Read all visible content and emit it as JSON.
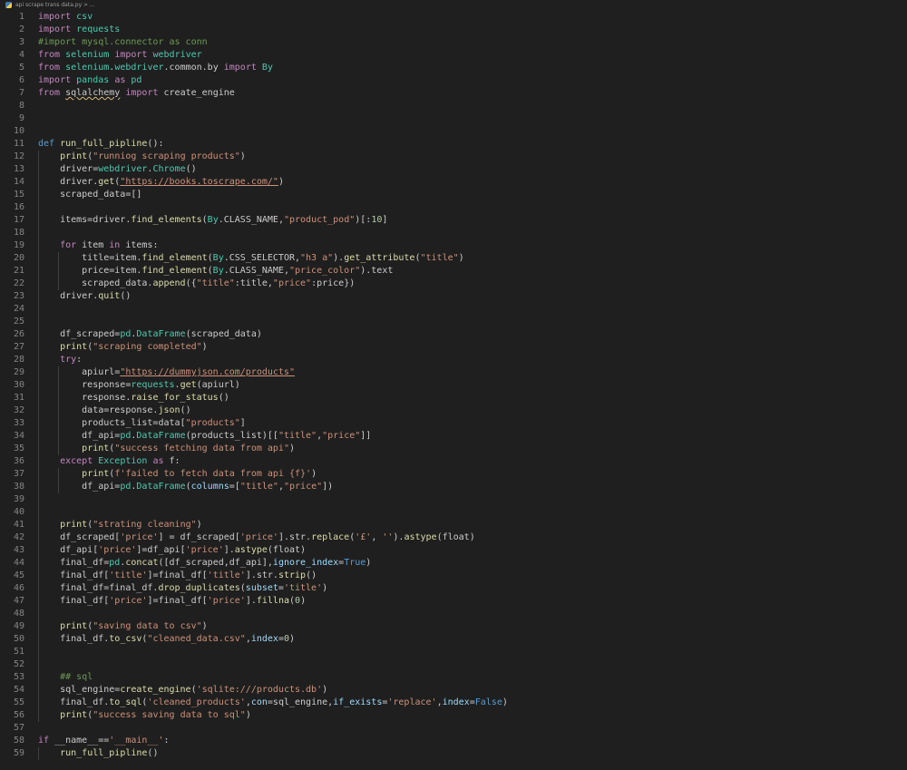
{
  "tab": {
    "breadcrumb": "api scrape trans data.py > ..."
  },
  "lines": [
    {
      "n": "1",
      "t": "import csv"
    },
    {
      "n": "2",
      "t": "import requests"
    },
    {
      "n": "3",
      "t": "#import mysql.connector as conn"
    },
    {
      "n": "4",
      "t": "from selenium import webdriver"
    },
    {
      "n": "5",
      "t": "from selenium.webdriver.common.by import By"
    },
    {
      "n": "6",
      "t": "import pandas as pd"
    },
    {
      "n": "7",
      "t": "from sqlalchemy import create_engine"
    },
    {
      "n": "8",
      "t": ""
    },
    {
      "n": "9",
      "t": ""
    },
    {
      "n": "10",
      "t": ""
    },
    {
      "n": "11",
      "t": "def run_full_pipline():"
    },
    {
      "n": "12",
      "t": "    print(\"runniog scraping products\")"
    },
    {
      "n": "13",
      "t": "    driver=webdriver.Chrome()"
    },
    {
      "n": "14",
      "t": "    driver.get(\"https://books.toscrape.com/\")"
    },
    {
      "n": "15",
      "t": "    scraped_data=[]"
    },
    {
      "n": "16",
      "t": ""
    },
    {
      "n": "17",
      "t": "    items=driver.find_elements(By.CLASS_NAME,\"product_pod\")[:10]"
    },
    {
      "n": "18",
      "t": ""
    },
    {
      "n": "19",
      "t": "    for item in items:"
    },
    {
      "n": "20",
      "t": "        title=item.find_element(By.CSS_SELECTOR,\"h3 a\").get_attribute(\"title\")"
    },
    {
      "n": "21",
      "t": "        price=item.find_element(By.CLASS_NAME,\"price_color\").text"
    },
    {
      "n": "22",
      "t": "        scraped_data.append({\"title\":title,\"price\":price})"
    },
    {
      "n": "23",
      "t": "    driver.quit()"
    },
    {
      "n": "24",
      "t": ""
    },
    {
      "n": "25",
      "t": ""
    },
    {
      "n": "26",
      "t": "    df_scraped=pd.DataFrame(scraped_data)"
    },
    {
      "n": "27",
      "t": "    print(\"scraping completed\")"
    },
    {
      "n": "28",
      "t": "    try:"
    },
    {
      "n": "29",
      "t": "        apiurl=\"https://dummyjson.com/products\""
    },
    {
      "n": "30",
      "t": "        response=requests.get(apiurl)"
    },
    {
      "n": "31",
      "t": "        response.raise_for_status()"
    },
    {
      "n": "32",
      "t": "        data=response.json()"
    },
    {
      "n": "33",
      "t": "        products_list=data[\"products\"]"
    },
    {
      "n": "34",
      "t": "        df_api=pd.DataFrame(products_list)[[\"title\",\"price\"]]"
    },
    {
      "n": "35",
      "t": "        print(\"success fetching data from api\")"
    },
    {
      "n": "36",
      "t": "    except Exception as f:"
    },
    {
      "n": "37",
      "t": "        print(f'failed to fetch data from api {f}')"
    },
    {
      "n": "38",
      "t": "        df_api=pd.DataFrame(columns=[\"title\",\"price\"])"
    },
    {
      "n": "39",
      "t": ""
    },
    {
      "n": "40",
      "t": ""
    },
    {
      "n": "41",
      "t": "    print(\"strating cleaning\")"
    },
    {
      "n": "42",
      "t": "    df_scraped['price'] = df_scraped['price'].str.replace('£', '').astype(float)"
    },
    {
      "n": "43",
      "t": "    df_api['price']=df_api['price'].astype(float)"
    },
    {
      "n": "44",
      "t": "    final_df=pd.concat([df_scraped,df_api],ignore_index=True)"
    },
    {
      "n": "45",
      "t": "    final_df['title']=final_df['title'].str.strip()"
    },
    {
      "n": "46",
      "t": "    final_df=final_df.drop_duplicates(subset='title')"
    },
    {
      "n": "47",
      "t": "    final_df['price']=final_df['price'].fillna(0)"
    },
    {
      "n": "48",
      "t": ""
    },
    {
      "n": "49",
      "t": "    print(\"saving data to csv\")"
    },
    {
      "n": "50",
      "t": "    final_df.to_csv(\"cleaned_data.csv\",index=0)"
    },
    {
      "n": "51",
      "t": ""
    },
    {
      "n": "52",
      "t": ""
    },
    {
      "n": "53",
      "t": "    ## sql"
    },
    {
      "n": "54",
      "t": "    sql_engine=create_engine('sqlite:///products.db')"
    },
    {
      "n": "55",
      "t": "    final_df.to_sql('cleaned_products',con=sql_engine,if_exists='replace',index=False)"
    },
    {
      "n": "56",
      "t": "    print(\"success saving data to sql\")"
    },
    {
      "n": "57",
      "t": ""
    },
    {
      "n": "58",
      "t": "if __name__=='__main__':"
    },
    {
      "n": "59",
      "t": "    run_full_pipline()"
    }
  ],
  "colors": {
    "background": "#1f1f1f",
    "line_number": "#858585",
    "text": "#cccccc",
    "keyword": "#c586c0",
    "string": "#ce9178",
    "function": "#dcdcaa",
    "module": "#4ec9b0",
    "variable": "#9cdcfe",
    "comment": "#6a9955"
  }
}
